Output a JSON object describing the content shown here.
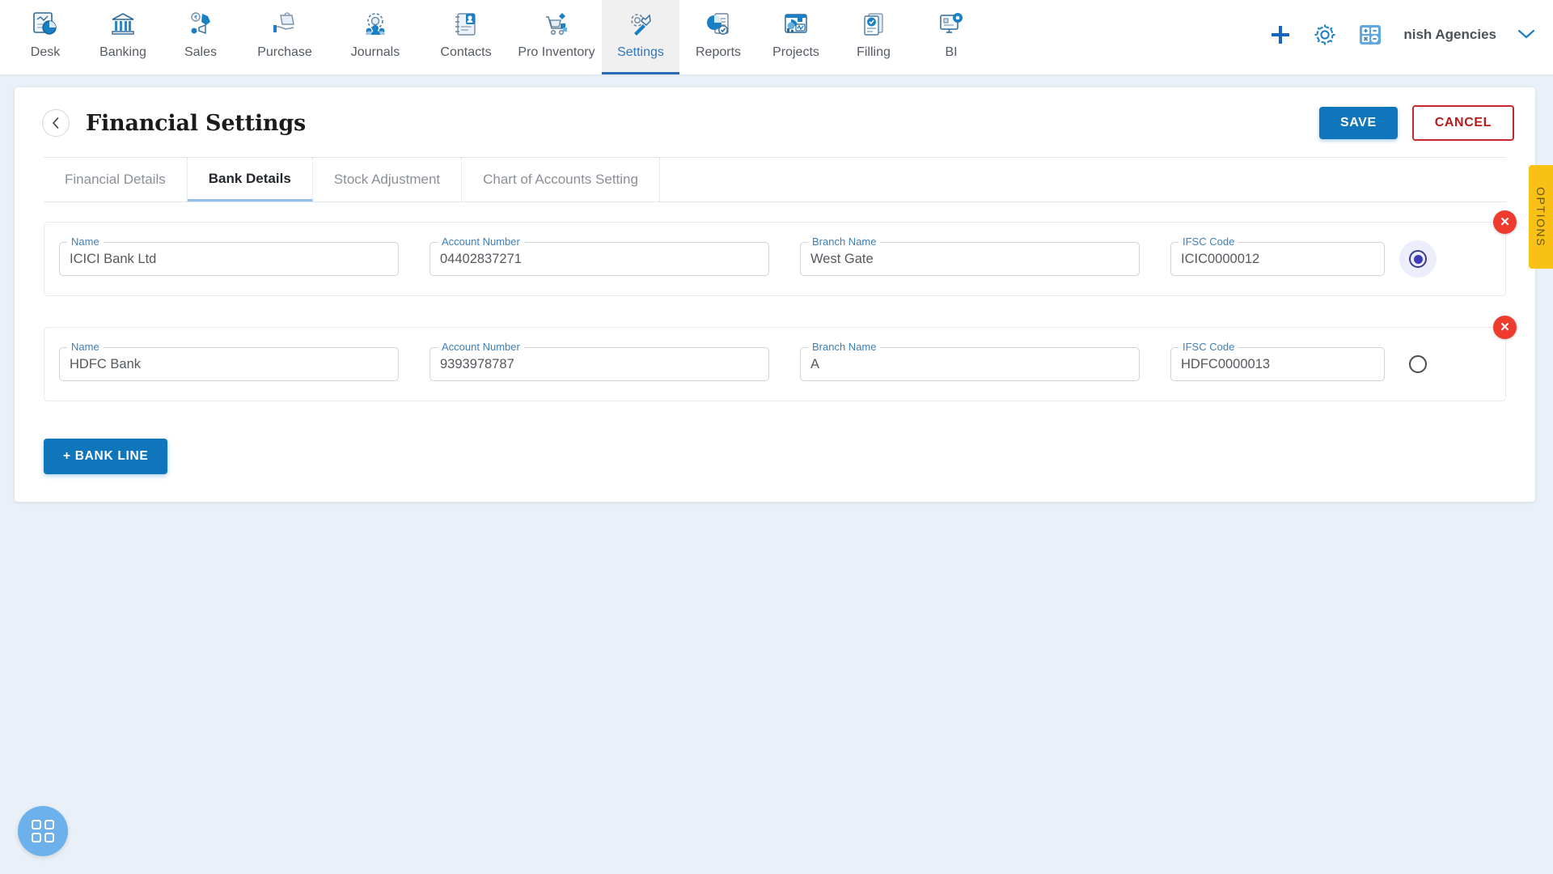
{
  "topnav": {
    "items": [
      {
        "label": "Desk",
        "icon": "dashboard-icon",
        "active": false
      },
      {
        "label": "Banking",
        "icon": "bank-icon",
        "active": false
      },
      {
        "label": "Sales",
        "icon": "sales-icon",
        "active": false
      },
      {
        "label": "Purchase",
        "icon": "purchase-icon",
        "active": false
      },
      {
        "label": "Journals",
        "icon": "journals-icon",
        "active": false
      },
      {
        "label": "Contacts",
        "icon": "contacts-icon",
        "active": false
      },
      {
        "label": "Pro Inventory",
        "icon": "inventory-icon",
        "active": false
      },
      {
        "label": "Settings",
        "icon": "settings-icon",
        "active": true
      },
      {
        "label": "Reports",
        "icon": "reports-icon",
        "active": false
      },
      {
        "label": "Projects",
        "icon": "projects-icon",
        "active": false
      },
      {
        "label": "Filling",
        "icon": "filling-icon",
        "active": false
      },
      {
        "label": "BI",
        "icon": "bi-icon",
        "active": false
      }
    ],
    "right": {
      "add_icon": "plus-icon",
      "settings_icon": "gear-icon",
      "calculator_icon": "calculator-icon",
      "organization": "nish Agencies",
      "chevron": "chevron-down-icon"
    }
  },
  "header": {
    "back_icon": "chevron-left-icon",
    "title": "Financial Settings",
    "save_label": "SAVE",
    "cancel_label": "CANCEL"
  },
  "tabs": [
    {
      "label": "Financial Details",
      "active": false
    },
    {
      "label": "Bank Details",
      "active": true
    },
    {
      "label": "Stock Adjustment",
      "active": false
    },
    {
      "label": "Chart of Accounts Setting",
      "active": false
    }
  ],
  "field_labels": {
    "name": "Name",
    "account_number": "Account Number",
    "branch_name": "Branch Name",
    "ifsc_code": "IFSC Code"
  },
  "bank_rows": [
    {
      "name": "ICICI Bank Ltd",
      "account_number": "04402837271",
      "branch_name": "West Gate",
      "ifsc_code": "ICIC0000012",
      "primary_selected": true,
      "delete_icon": "close-icon"
    },
    {
      "name": "HDFC Bank",
      "account_number": "9393978787",
      "branch_name": "A",
      "ifsc_code": "HDFC0000013",
      "primary_selected": false,
      "delete_icon": "close-icon"
    }
  ],
  "add_bank_line_label": "+ BANK LINE",
  "options_tab": {
    "label": "OPTIONS"
  },
  "fab": {
    "icon": "apps-grid-icon"
  },
  "colors": {
    "accent_blue": "#0f76bc",
    "danger_red": "#c62828",
    "delete_red": "#ef3b2d",
    "options_yellow": "#f9c116",
    "page_bg": "#eaf0f8",
    "label_blue": "#3f7fb5"
  }
}
